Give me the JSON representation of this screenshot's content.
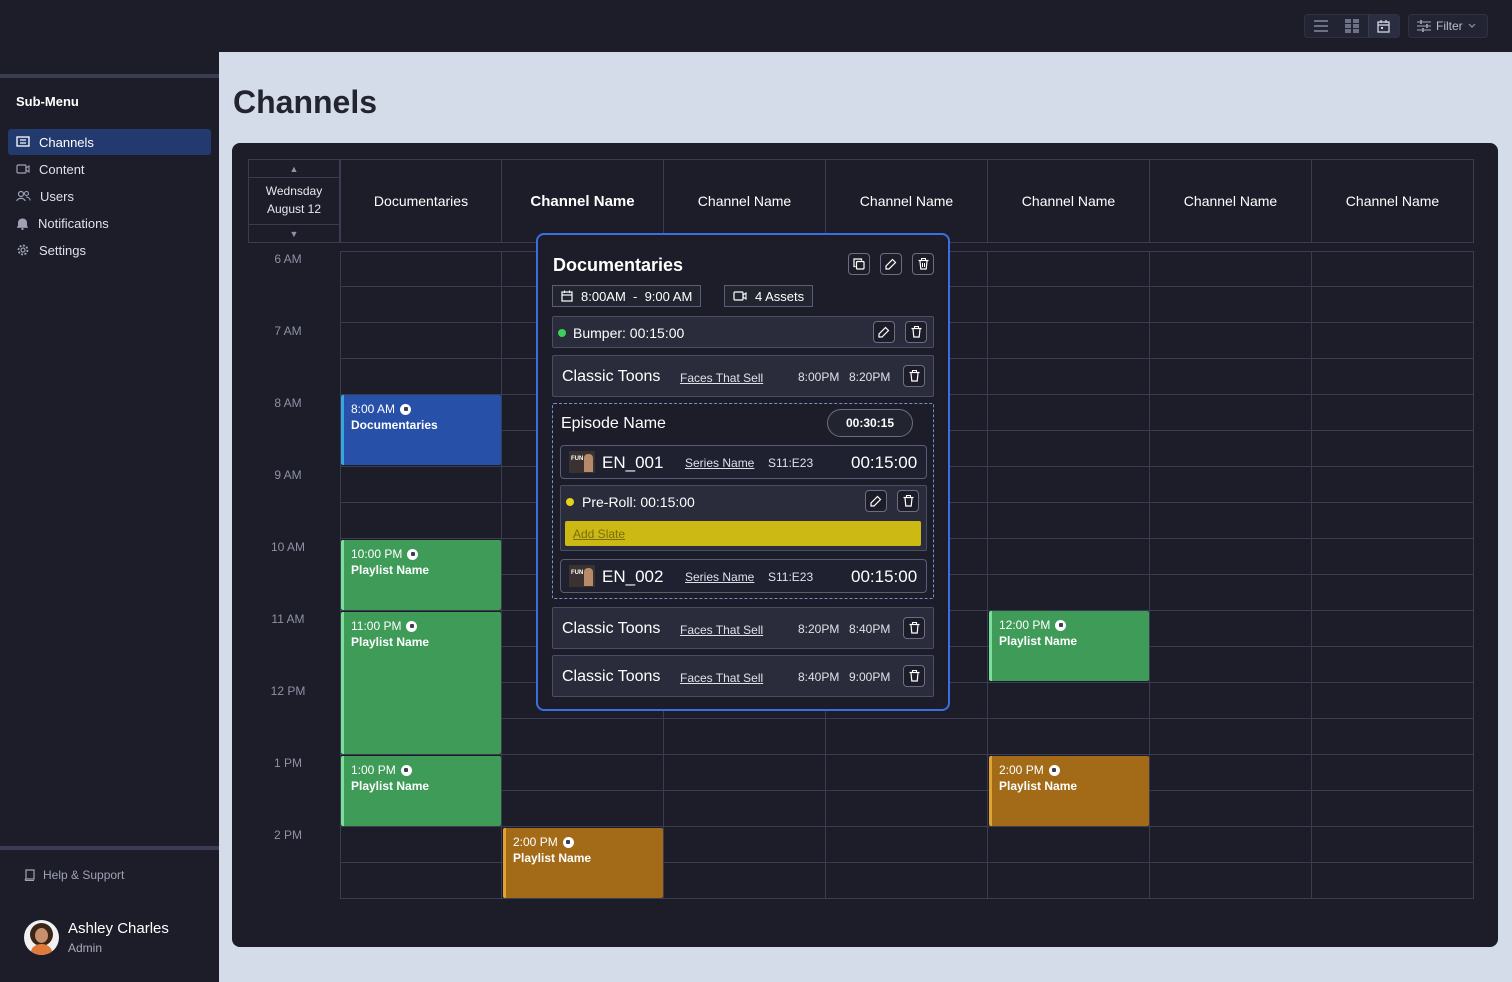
{
  "topbar": {
    "views": [
      "list-view-icon",
      "grid-view-icon",
      "calendar-view-icon"
    ],
    "filter_label": "Filter"
  },
  "sidebar": {
    "title": "Sub-Menu",
    "items": [
      {
        "label": "Channels",
        "icon": "channels-icon",
        "active": true
      },
      {
        "label": "Content",
        "icon": "video-icon"
      },
      {
        "label": "Users",
        "icon": "users-icon"
      },
      {
        "label": "Notifications",
        "icon": "bell-icon"
      },
      {
        "label": "Settings",
        "icon": "gear-icon"
      }
    ],
    "help_label": "Help & Support",
    "user": {
      "name": "Ashley Charles",
      "role": "Admin"
    }
  },
  "main": {
    "title": "Channels"
  },
  "schedule": {
    "date_line1": "Wednsday",
    "date_line2": "August 12",
    "columns": [
      "Documentaries",
      "Channel Name",
      "Channel Name",
      "Channel Name",
      "Channel Name",
      "Channel Name",
      "Channel Name"
    ],
    "times": [
      "6 AM",
      "7 AM",
      "8 AM",
      "9 AM",
      "10 AM",
      "11 AM",
      "12 PM",
      "1 PM",
      "2 PM"
    ],
    "events": [
      {
        "time": "8:00 AM",
        "name": "Documentaries"
      },
      {
        "time": "10:00 PM",
        "name": "Playlist Name"
      },
      {
        "time": "11:00 PM",
        "name": "Playlist Name"
      },
      {
        "time": "1:00 PM",
        "name": "Playlist Name"
      },
      {
        "time": "2:00 PM",
        "name": "Playlist Name"
      },
      {
        "time": "12:00 PM",
        "name": "Playlist Name"
      },
      {
        "time": "2:00 PM",
        "name": "Playlist Name"
      }
    ]
  },
  "popup": {
    "title": "Documentaries",
    "time_range": "8:00AM  -  9:00 AM",
    "assets": "4 Assets",
    "bumper": "Bumper: 00:15:00",
    "rows": [
      {
        "title": "Classic Toons",
        "link": "Faces That Sell",
        "start": "8:00PM",
        "end": "8:20PM"
      },
      {
        "title": "Classic Toons",
        "link": "Faces That Sell",
        "start": "8:20PM",
        "end": "8:40PM"
      },
      {
        "title": "Classic Toons",
        "link": "Faces That Sell",
        "start": "8:40PM",
        "end": "9:00PM"
      }
    ],
    "episode": {
      "title": "Episode Name",
      "duration": "00:30:15",
      "items": [
        {
          "code": "EN_001",
          "series": "Series Name",
          "se": "S11:E23",
          "duration": "00:15:00"
        },
        {
          "code": "EN_002",
          "series": "Series Name",
          "se": "S11:E23",
          "duration": "00:15:00"
        }
      ],
      "preroll": "Pre-Roll: 00:15:00",
      "add_slate": "Add Slate"
    }
  }
}
